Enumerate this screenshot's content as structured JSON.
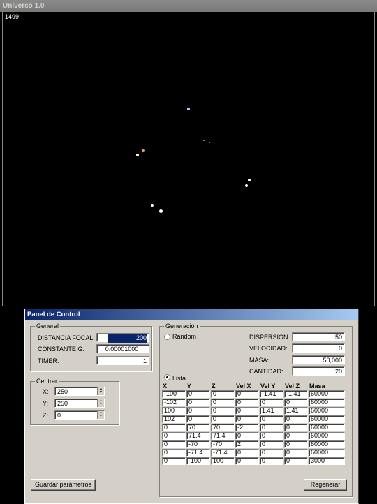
{
  "window": {
    "title": "Universo 1.0"
  },
  "simulation": {
    "step_counter": "1499",
    "stars": [
      {
        "color": "#b8d0ff"
      },
      {
        "color": "#d0a080"
      },
      {
        "color": "#ffffcc"
      },
      {
        "color": "#c8a080"
      },
      {
        "color": "#ff9966"
      },
      {
        "color": "#ffffff"
      },
      {
        "color": "#ffffcc"
      },
      {
        "color": "#ffffff"
      },
      {
        "color": "#ffffff"
      },
      {
        "color": "#cccccc"
      }
    ]
  },
  "panel": {
    "title": "Panel de Control",
    "general": {
      "legend": "General",
      "distancia_focal_label": "DISTANCIA FOCAL:",
      "distancia_focal_value": "200",
      "constante_g_label": "CONSTANTE G:",
      "constante_g_value": "0.00001000",
      "timer_label": "TIMER:",
      "timer_value": "1"
    },
    "centrar": {
      "legend": "Centrar",
      "x_label": "X:",
      "x_value": "250",
      "y_label": "Y:",
      "y_value": "250",
      "z_label": "Z:",
      "z_value": "0"
    },
    "save_button": "Guardar parámetros",
    "generacion": {
      "legend": "Generación",
      "random_label": "Random",
      "random_selected": false,
      "lista_label": "Lista",
      "lista_selected": true,
      "dispersion_label": "DISPERSION:",
      "dispersion_value": "50",
      "velocidad_label": "VELOCIDAD:",
      "velocidad_value": "0",
      "masa_label": "MASA:",
      "masa_value": "50,000",
      "cantidad_label": "CANTIDAD:",
      "cantidad_value": "20",
      "columns": [
        "X",
        "Y",
        "Z",
        "Vel X",
        "Vel Y",
        "Vel Z",
        "Masa"
      ],
      "rows": [
        [
          "-100",
          "0",
          "0",
          "0",
          "-1.41",
          "-1.41",
          "60000"
        ],
        [
          "-102",
          "0",
          "0",
          "0",
          "0",
          "0",
          "60000"
        ],
        [
          "100",
          "0",
          "0",
          "0",
          "1.41",
          "1.41",
          "60000"
        ],
        [
          "102",
          "0",
          "0",
          "0",
          "0",
          "0",
          "60000"
        ],
        [
          "0",
          "70",
          "70",
          "-2",
          "0",
          "0",
          "60000"
        ],
        [
          "0",
          "71.4",
          "71.4",
          "0",
          "0",
          "0",
          "60000"
        ],
        [
          "0",
          "-70",
          "-70",
          "2",
          "0",
          "0",
          "60000"
        ],
        [
          "0",
          "-71.4",
          "-71.4",
          "0",
          "0",
          "0",
          "60000"
        ],
        [
          "0",
          "-100",
          "100",
          "0",
          "0",
          "0",
          "3000"
        ]
      ],
      "regenerate_button": "Regenerar"
    }
  }
}
